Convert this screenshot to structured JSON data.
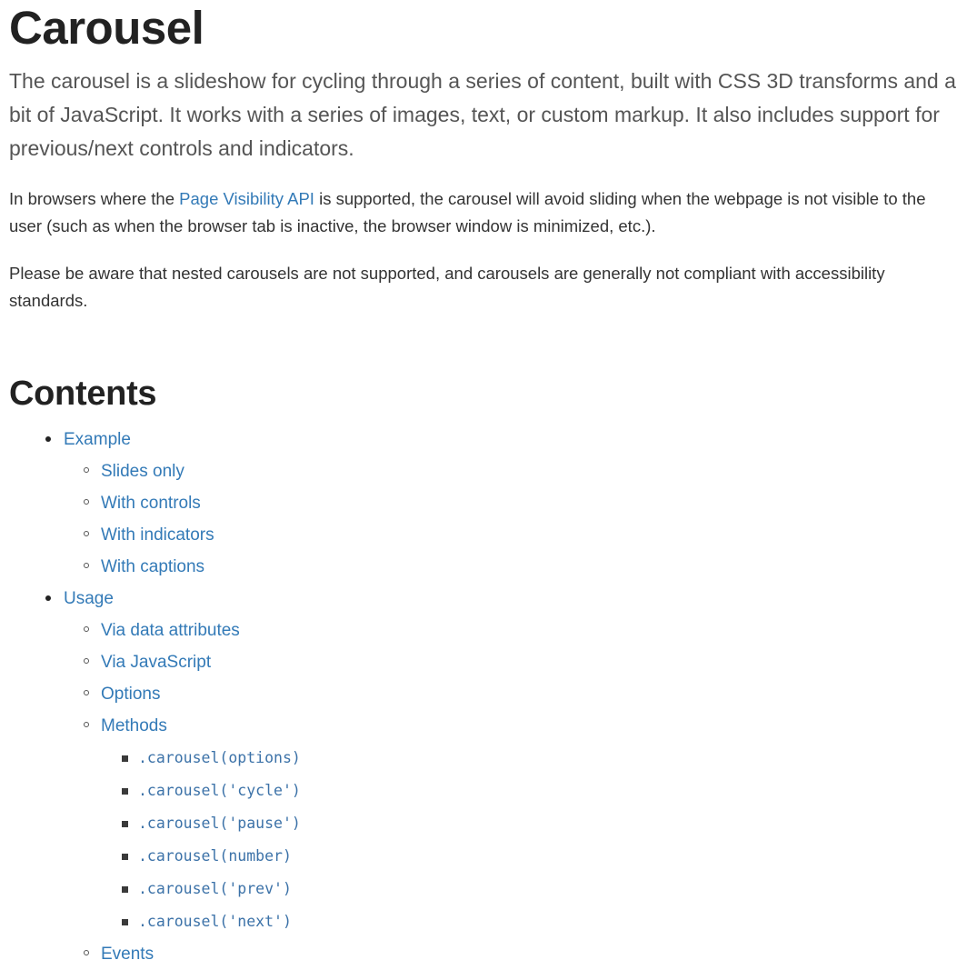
{
  "page": {
    "title": "Carousel",
    "lead": "The carousel is a slideshow for cycling through a series of content, built with CSS 3D transforms and a bit of JavaScript. It works with a series of images, text, or custom markup. It also includes support for previous/next controls and indicators.",
    "paragraph_2": {
      "before_link": "In browsers where the ",
      "link_text": "Page Visibility API",
      "after_link": " is supported, the carousel will avoid sliding when the webpage is not visible to the user (such as when the browser tab is inactive, the browser window is minimized, etc.)."
    },
    "paragraph_3": "Please be aware that nested carousels are not supported, and carousels are generally not compliant with accessibility standards."
  },
  "contents": {
    "heading": "Contents",
    "items": [
      {
        "label": "Example",
        "children": [
          {
            "label": "Slides only"
          },
          {
            "label": "With controls"
          },
          {
            "label": "With indicators"
          },
          {
            "label": "With captions"
          }
        ]
      },
      {
        "label": "Usage",
        "children": [
          {
            "label": "Via data attributes"
          },
          {
            "label": "Via JavaScript"
          },
          {
            "label": "Options"
          },
          {
            "label": "Methods",
            "children": [
              {
                "label": ".carousel(options)"
              },
              {
                "label": ".carousel('cycle')"
              },
              {
                "label": ".carousel('pause')"
              },
              {
                "label": ".carousel(number)"
              },
              {
                "label": ".carousel('prev')"
              },
              {
                "label": ".carousel('next')"
              }
            ]
          },
          {
            "label": "Events"
          }
        ]
      }
    ]
  },
  "colors": {
    "link": "#337ab7",
    "code_link": "#3c72a8",
    "heading": "#222222",
    "body_text": "#333333",
    "lead_text": "#555555",
    "background": "#ffffff"
  }
}
